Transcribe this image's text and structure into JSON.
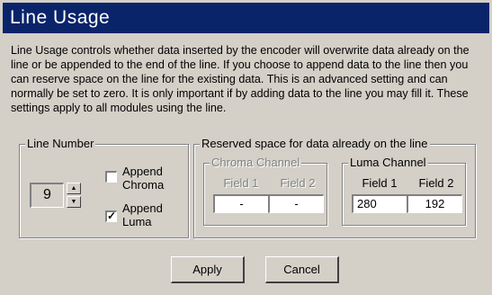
{
  "title": "Line Usage",
  "description": "Line Usage controls whether data inserted by the encoder will overwrite data already on the line or be appended to the end of the line.  If you choose to append data to the line then you can reserve space on the line for the existing data.  This is an advanced setting and can normally be set to zero.  It is only important if by adding data to the line you may fill it.  These settings apply to all modules using the line.",
  "line_number": {
    "legend": "Line Number",
    "value": "9",
    "append_chroma": {
      "label_line1": "Append",
      "label_line2": "Chroma",
      "checked": false
    },
    "append_luma": {
      "label_line1": "Append",
      "label_line2": "Luma",
      "checked": true
    }
  },
  "reserved": {
    "legend": "Reserved space for data already on the line",
    "chroma": {
      "legend": "Chroma Channel",
      "enabled": false,
      "field1_label": "Field 1",
      "field2_label": "Field 2",
      "field1_value": "-",
      "field2_value": "-"
    },
    "luma": {
      "legend": "Luma Channel",
      "enabled": true,
      "field1_label": "Field 1",
      "field2_label": "Field 2",
      "field1_value": "280",
      "field2_value": "192"
    }
  },
  "buttons": {
    "apply": "Apply",
    "cancel": "Cancel"
  },
  "icons": {
    "spin_up": "arrow-up-icon",
    "spin_down": "arrow-down-icon",
    "check": "checkmark-icon"
  }
}
